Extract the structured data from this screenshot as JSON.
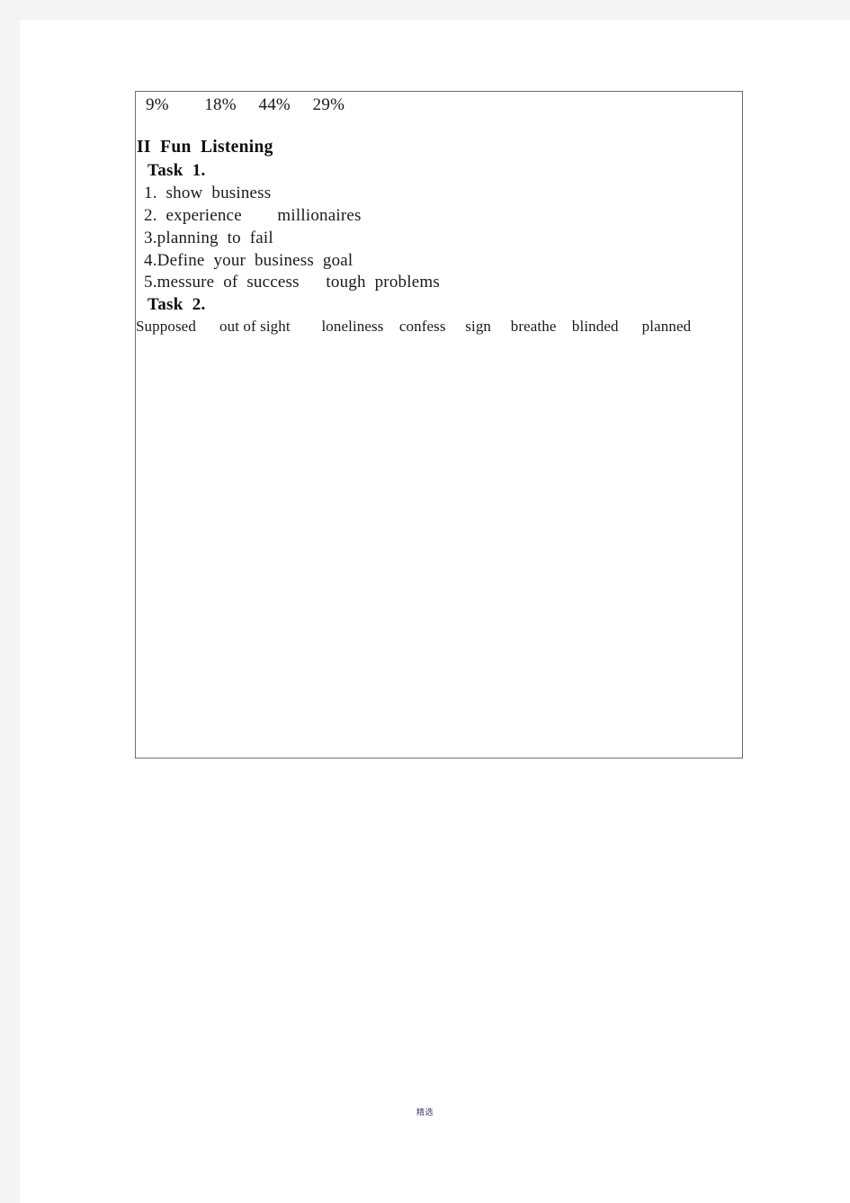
{
  "page": {
    "footer_text": "精选"
  },
  "content_box": {
    "percent_row": {
      "values": [
        "9%",
        "18%",
        "44%",
        "29%"
      ],
      "rendered": "9%        18%     44%     29%"
    },
    "section": {
      "heading": "II  Fun  Listening"
    },
    "task1": {
      "label": "Task  1.",
      "answers": [
        "1.  show  business",
        "2.  experience        millionaires",
        "3.planning  to  fail",
        "4.Define  your  business  goal",
        "5.messure  of  success      tough  problems"
      ]
    },
    "task2": {
      "label": "Task  2.",
      "words": [
        "Supposed",
        "out of sight",
        "loneliness",
        "confess",
        "sign",
        "breathe",
        "blinded",
        "planned"
      ],
      "rendered": "Supposed      out of sight        loneliness    confess     sign     breathe    blinded      planned"
    }
  }
}
